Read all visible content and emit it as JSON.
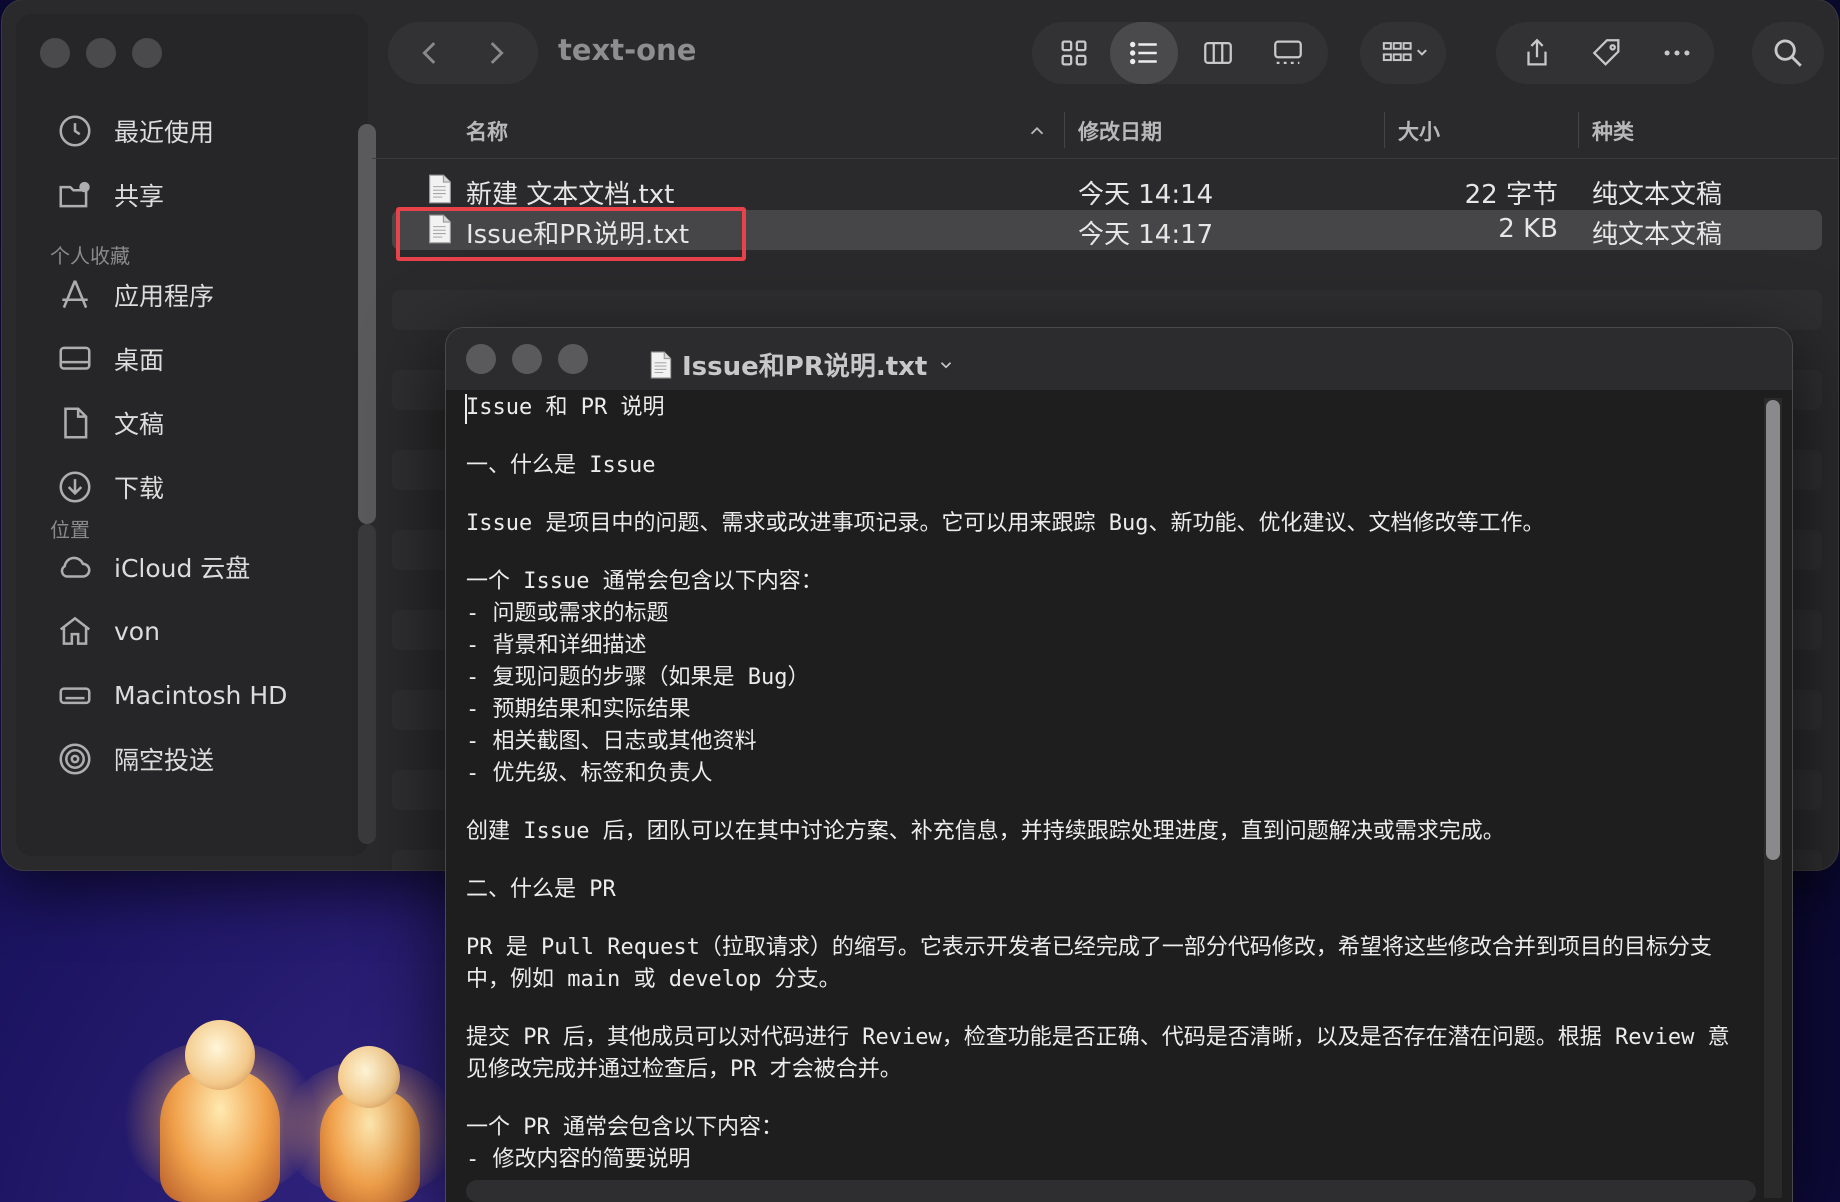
{
  "finder": {
    "folder_title": "text-one",
    "sidebar": {
      "items_top": [
        {
          "label": "最近使用",
          "icon": "clock-icon"
        },
        {
          "label": "共享",
          "icon": "shared-folder-icon"
        }
      ],
      "favorites_header": "个人收藏",
      "favorites": [
        {
          "label": "应用程序",
          "icon": "applications-icon"
        },
        {
          "label": "桌面",
          "icon": "desktop-icon"
        },
        {
          "label": "文稿",
          "icon": "document-icon"
        },
        {
          "label": "下载",
          "icon": "download-icon"
        }
      ],
      "locations_header": "位置",
      "locations": [
        {
          "label": "iCloud 云盘",
          "icon": "cloud-icon"
        },
        {
          "label": "von",
          "icon": "home-icon"
        },
        {
          "label": "Macintosh HD",
          "icon": "disk-icon"
        },
        {
          "label": "隔空投送",
          "icon": "airdrop-icon"
        }
      ]
    },
    "columns": {
      "name": "名称",
      "modified": "修改日期",
      "size": "大小",
      "kind": "种类"
    },
    "files": [
      {
        "name": "新建 文本文档.txt",
        "modified": "今天 14:14",
        "size": "22 字节",
        "kind": "纯文本文稿"
      },
      {
        "name": "Issue和PR说明.txt",
        "modified": "今天 14:17",
        "size": "2 KB",
        "kind": "纯文本文稿"
      }
    ]
  },
  "textedit": {
    "title": "Issue和PR说明.txt",
    "lines": [
      "Issue 和 PR 说明",
      "",
      "一、什么是 Issue",
      "",
      "Issue 是项目中的问题、需求或改进事项记录。它可以用来跟踪 Bug、新功能、优化建议、文档修改等工作。",
      "",
      "一个 Issue 通常会包含以下内容：",
      "- 问题或需求的标题",
      "- 背景和详细描述",
      "- 复现问题的步骤（如果是 Bug）",
      "- 预期结果和实际结果",
      "- 相关截图、日志或其他资料",
      "- 优先级、标签和负责人",
      "",
      "创建 Issue 后，团队可以在其中讨论方案、补充信息，并持续跟踪处理进度，直到问题解决或需求完成。",
      "",
      "二、什么是 PR",
      "",
      "PR 是 Pull Request（拉取请求）的缩写。它表示开发者已经完成了一部分代码修改，希望将这些修改合并到项目的目标分支",
      "中，例如 main 或 develop 分支。",
      "",
      "提交 PR 后，其他成员可以对代码进行 Review，检查功能是否正确、代码是否清晰，以及是否存在潜在问题。根据 Review 意",
      "见修改完成并通过检查后，PR 才会被合并。",
      "",
      "一个 PR 通常会包含以下内容：",
      "- 修改内容的简要说明"
    ]
  },
  "colors": {
    "selection_box": "#e8434a",
    "selected_row": "#464648"
  }
}
